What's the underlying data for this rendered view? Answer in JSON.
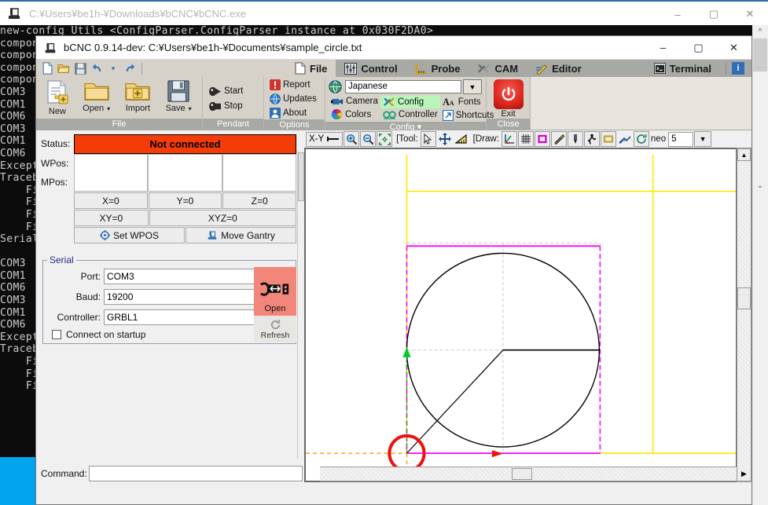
{
  "outer_window": {
    "title": "C:¥Users¥be1h-¥Downloads¥bCNC¥bCNC.exe",
    "minimize": "–",
    "maximize": "▢",
    "close": "✕",
    "console_lines": [
      "new-config Utils <ConfigParser.ConfigParser instance at 0x030F2DA0>",
      "component",
      "component",
      "component",
      "component",
      "COM3",
      "COM1",
      "COM6",
      "COM3",
      "COM1",
      "COM6",
      "Exception",
      "Traceback",
      "    File",
      "    File",
      "    File",
      "    File",
      "Serial",
      "",
      "COM3",
      "COM1",
      "COM6",
      "COM3",
      "COM1",
      "COM6",
      "Exception",
      "Traceback",
      "    File",
      "    File",
      "    File"
    ]
  },
  "app": {
    "title": "bCNC 0.9.14-dev: C:¥Users¥be1h-¥Documents¥sample_circle.txt",
    "minimize": "–",
    "maximize": "▢",
    "close": "✕"
  },
  "quick_access": {
    "new": "new-file-icon",
    "open": "open-folder-icon",
    "save": "save-disk-icon",
    "undo": "undo-icon",
    "undo_menu": "▾",
    "redo": "redo-icon"
  },
  "tabs": [
    {
      "label": "File",
      "icon": "page-icon",
      "active": true
    },
    {
      "label": "Control",
      "icon": "sliders-icon",
      "active": false
    },
    {
      "label": "Probe",
      "icon": "ruler-icon",
      "active": false
    },
    {
      "label": "CAM",
      "icon": "tools-icon",
      "active": false
    },
    {
      "label": "Editor",
      "icon": "pencil-icon",
      "active": false
    }
  ],
  "right_tabs": [
    {
      "label": "Terminal",
      "icon": "terminal-icon"
    }
  ],
  "info_button": {
    "label": "i",
    "name": "info-icon"
  },
  "ribbon": {
    "file_group": {
      "label": "File",
      "buttons": [
        {
          "label": "New",
          "icon": "new-document-icon"
        },
        {
          "label": "Open",
          "icon": "folder-icon",
          "dropdown": "▾"
        },
        {
          "label": "Import",
          "icon": "folder-plus-icon"
        },
        {
          "label": "Save",
          "icon": "floppy-icon",
          "dropdown": "▾"
        }
      ]
    },
    "pendant_group": {
      "label": "Pendant",
      "buttons": [
        {
          "label": "Start",
          "icon": "start-icon"
        },
        {
          "label": "Stop",
          "icon": "stop-icon"
        }
      ]
    },
    "options_group": {
      "label": "Options",
      "buttons": [
        {
          "label": "Report",
          "icon": "exclamation-icon"
        },
        {
          "label": "Updates",
          "icon": "globe-icon"
        },
        {
          "label": "About",
          "icon": "person-icon"
        }
      ]
    },
    "config_group": {
      "label": "Config",
      "label_dropdown": "▾",
      "language_value": "Japanese",
      "language_icon": "globe-icon",
      "language_dropdown": "▼",
      "buttons": [
        {
          "label": "Camera",
          "icon": "camera-icon",
          "highlighted": false
        },
        {
          "label": "Config",
          "icon": "wrench-icon",
          "highlighted": true
        },
        {
          "label": "Fonts",
          "icon": "font-icon",
          "highlighted": false
        },
        {
          "label": "Colors",
          "icon": "colorwheel-icon",
          "highlighted": false
        },
        {
          "label": "Controller",
          "icon": "chip-icon",
          "highlighted": false
        },
        {
          "label": "Shortcuts",
          "icon": "arrow-box-icon",
          "highlighted": false
        }
      ]
    },
    "close_group": {
      "label": "Close",
      "exit_label": "Exit",
      "exit_icon": "power-icon"
    }
  },
  "state_panel": {
    "status_label": "Status:",
    "status_value": "Not connected",
    "status_color": "#f43c06",
    "wpos_label": "WPos:",
    "mpos_label": "MPos:",
    "wpos_values": [
      "",
      "",
      ""
    ],
    "mpos_values": [
      "",
      "",
      ""
    ],
    "zero_buttons": [
      "X=0",
      "Y=0",
      "Z=0"
    ],
    "zero_buttons2": [
      "XY=0",
      "XYZ=0"
    ],
    "action_buttons": [
      {
        "label": "Set WPOS",
        "icon": "crosshair-icon"
      },
      {
        "label": "Move Gantry",
        "icon": "gantry-icon"
      }
    ]
  },
  "serial": {
    "legend": "Serial",
    "fields": [
      {
        "label": "Port:",
        "value": "COM3",
        "dropdown": "▼"
      },
      {
        "label": "Baud:",
        "value": "19200",
        "dropdown": "▼"
      },
      {
        "label": "Controller:",
        "value": "GRBL1",
        "dropdown": "▼"
      }
    ],
    "checkbox_label": "Connect on startup",
    "checkbox_checked": false,
    "open_button": {
      "label": "Open",
      "icon": "usb-plug-icon",
      "color": "#f2867a"
    },
    "refresh_button": {
      "label": "Refresh",
      "icon": "refresh-icon"
    }
  },
  "canvas_toolbar": {
    "view_value": "X-Y",
    "view_icon": "view-axis-icon",
    "zoom_in": "zoom-in-icon",
    "zoom_out": "zoom-out-icon",
    "zoom_fit": "zoom-fit-icon",
    "tool_label": "[Tool:",
    "tool_buttons": [
      "cursor-icon",
      "move-icon",
      "ruler-triangle-icon"
    ],
    "draw_label": "[Draw:",
    "draw_buttons": [
      "axes-icon",
      "grid-icon",
      "margins-icon",
      "ruler-icon",
      "endmill-icon",
      "workarea-icon",
      "rapid-icon",
      "paths-icon",
      "camera-rotate-icon"
    ],
    "neo_label": "neo",
    "neo_value": "5",
    "neo_dropdown": "▼"
  },
  "canvas": {
    "colors": {
      "workarea": "#ffe800",
      "margin": "#ff00ff",
      "grid": "#c8c8c8",
      "path": "#000000",
      "origin_marker": "#ee1111",
      "xaxis": "#ff9900",
      "yaxis": "#00bb22",
      "arrow_x": "#ee1111",
      "arrow_y": "#00cc22"
    }
  },
  "command_bar": {
    "label": "Command:",
    "value": "",
    "left_arrow": "◀"
  },
  "scrollbars": {
    "up": "▲",
    "down": "▼",
    "left": "◀",
    "right": "▶"
  }
}
